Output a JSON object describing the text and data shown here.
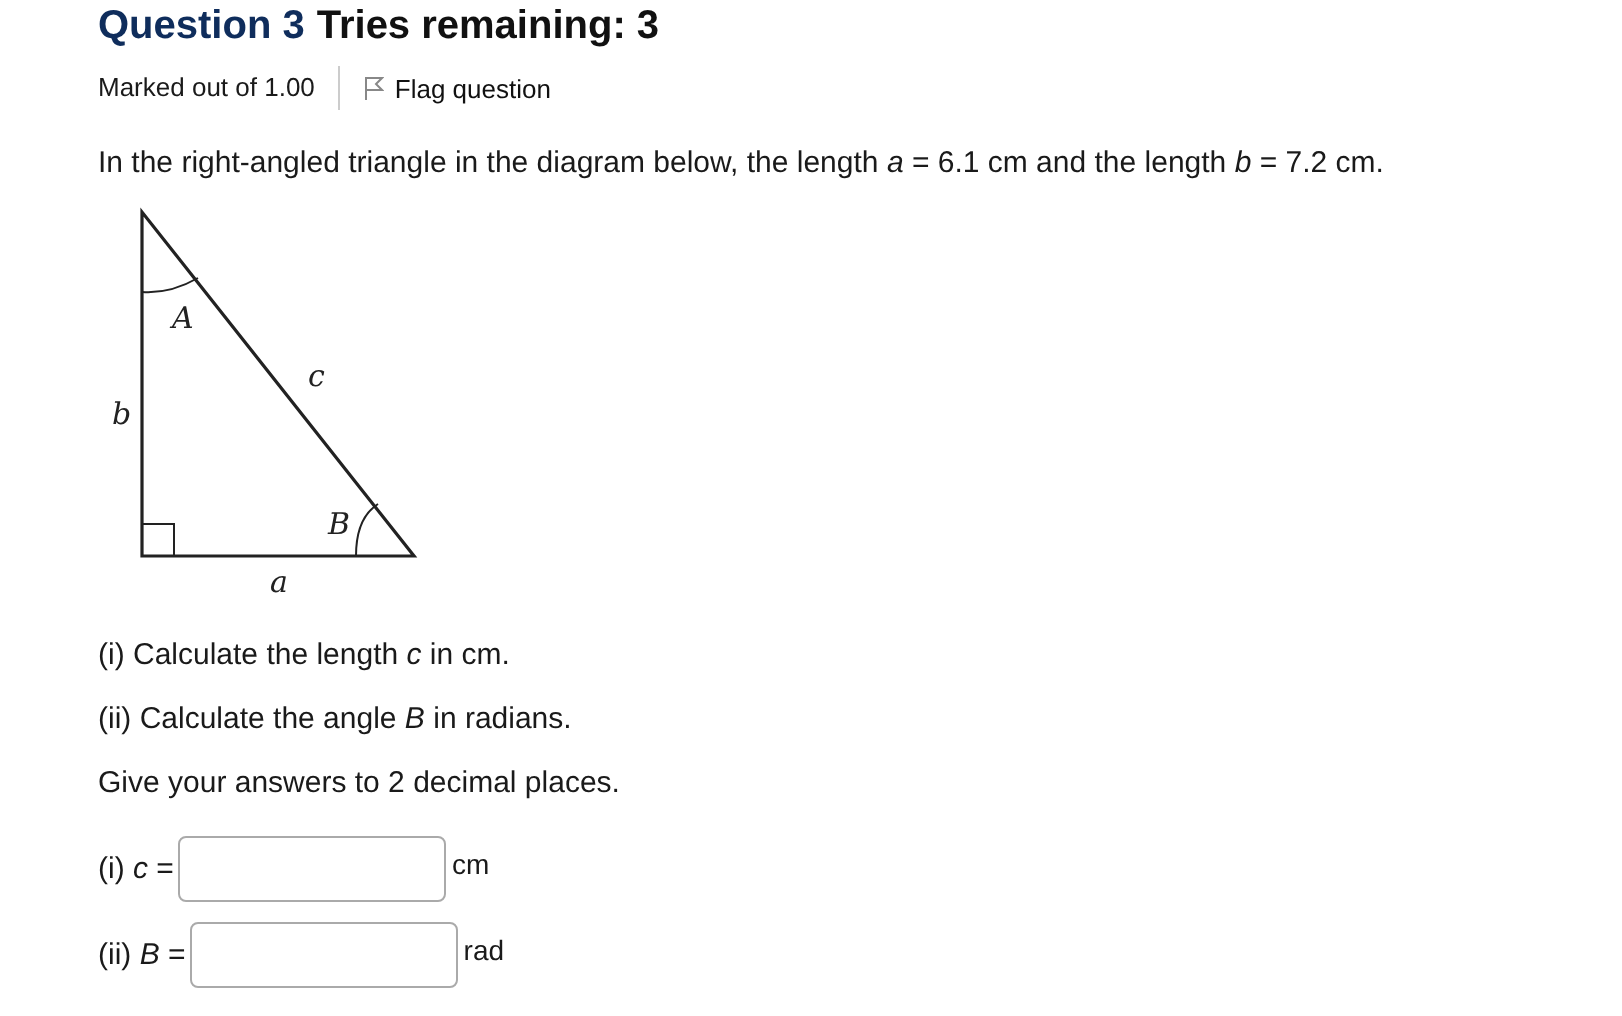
{
  "question": {
    "number_label": "Question 3",
    "tries": "Tries remaining: 3"
  },
  "meta": {
    "marks": "Marked out of 1.00",
    "flag_label": "Flag question",
    "flagged": false
  },
  "prompt": "In the right-angled triangle in the diagram below, the length *a* = 6.1 cm and the length *b* = 7.2 cm.",
  "diagram": {
    "labels": [
      {
        "kind": "angle_top",
        "text": "A"
      },
      {
        "kind": "side_hyp",
        "text": "c"
      },
      {
        "kind": "side_left",
        "text": "b"
      },
      {
        "kind": "angle_bottom",
        "text": "B"
      },
      {
        "kind": "side_bottom",
        "text": "a"
      }
    ]
  },
  "instructions": [
    "(i) Calculate the length *c* in cm.",
    "(ii) Calculate the angle *B* in radians.",
    "Give your answers to 2 decimal places."
  ],
  "answers": [
    {
      "label": "(i) *c* =",
      "unit": "cm"
    },
    {
      "label": "(ii) *B* =",
      "unit": "rad"
    }
  ]
}
